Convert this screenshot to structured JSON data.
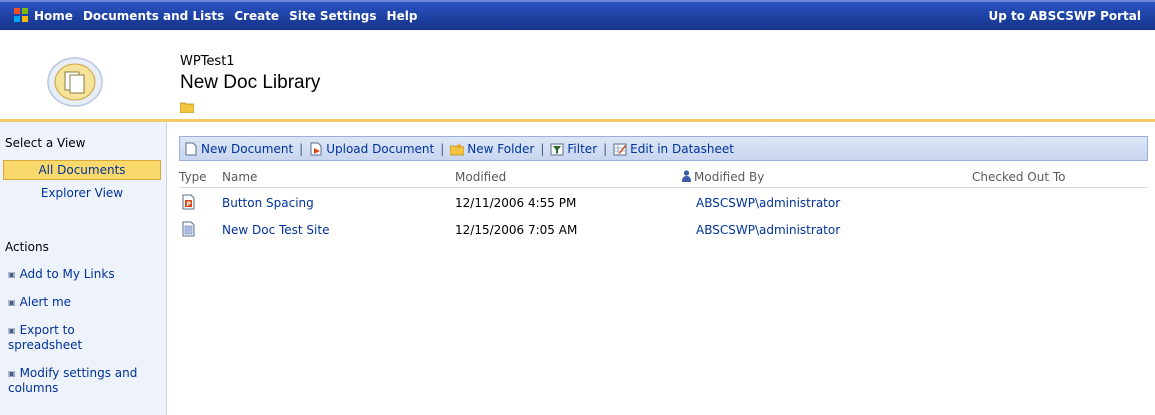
{
  "topbar": {
    "nav": [
      "Home",
      "Documents and Lists",
      "Create",
      "Site Settings",
      "Help"
    ],
    "portal_link": "Up to ABSCSWP Portal"
  },
  "header": {
    "site_name": "WPTest1",
    "page_title": "New Doc Library"
  },
  "sidebar": {
    "select_view_title": "Select a View",
    "views": [
      "All Documents",
      "Explorer View"
    ],
    "actions_title": "Actions",
    "actions": [
      "Add to My Links",
      "Alert me",
      "Export to spreadsheet",
      "Modify settings and columns"
    ]
  },
  "toolbar": {
    "new_document": "New Document",
    "upload_document": "Upload Document",
    "new_folder": "New Folder",
    "filter": "Filter",
    "edit_datasheet": "Edit in Datasheet",
    "separator": "|"
  },
  "table": {
    "columns": [
      "Type",
      "Name",
      "Modified",
      "Modified By",
      "Checked Out To"
    ],
    "rows": [
      {
        "name": "Button Spacing",
        "modified": "12/11/2006 4:55 PM",
        "modified_by": "ABSCSWP\\administrator",
        "checked_out_to": ""
      },
      {
        "name": "New Doc Test Site",
        "modified": "12/15/2006 7:05 AM",
        "modified_by": "ABSCSWP\\administrator",
        "checked_out_to": ""
      }
    ]
  },
  "colors": {
    "nav_bar": "#1c3f9e",
    "link": "#003399",
    "selected_view": "#f9d86c",
    "header_rule": "#f4c96a",
    "sidebar_bg": "#eef2fa"
  }
}
